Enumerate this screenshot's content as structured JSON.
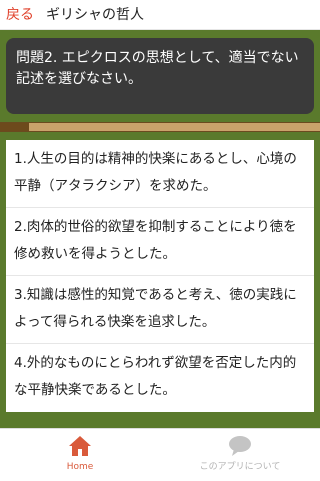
{
  "header": {
    "back_label": "戻る",
    "title": "ギリシャの哲人"
  },
  "question": {
    "text": "問題2. エピクロスの思想として、適当でない記述を選びなさい。"
  },
  "progress": {
    "fraction": 0.09
  },
  "answers": [
    "1.人生の目的は精神的快楽にあるとし、心境の平静（アタラクシア）を求めた。",
    "2.肉体的世俗的欲望を抑制することにより徳を修め救いを得ようとした。",
    "3.知識は感性的知覚であると考え、徳の実践によって得られる快楽を追求した。",
    "4.外的なものにとらわれず欲望を否定した内的な平静快楽であるとした。"
  ],
  "tabbar": {
    "home_label": "Home",
    "about_label": "このアプリについて",
    "home_icon": "home-icon",
    "about_icon": "speech-bubble-icon",
    "active_color": "#d95a3b",
    "inactive_color": "#b3b3b3"
  },
  "colors": {
    "accent": "#e0412b",
    "background": "#5a7a2c",
    "question_box": "#3a3a3a"
  }
}
